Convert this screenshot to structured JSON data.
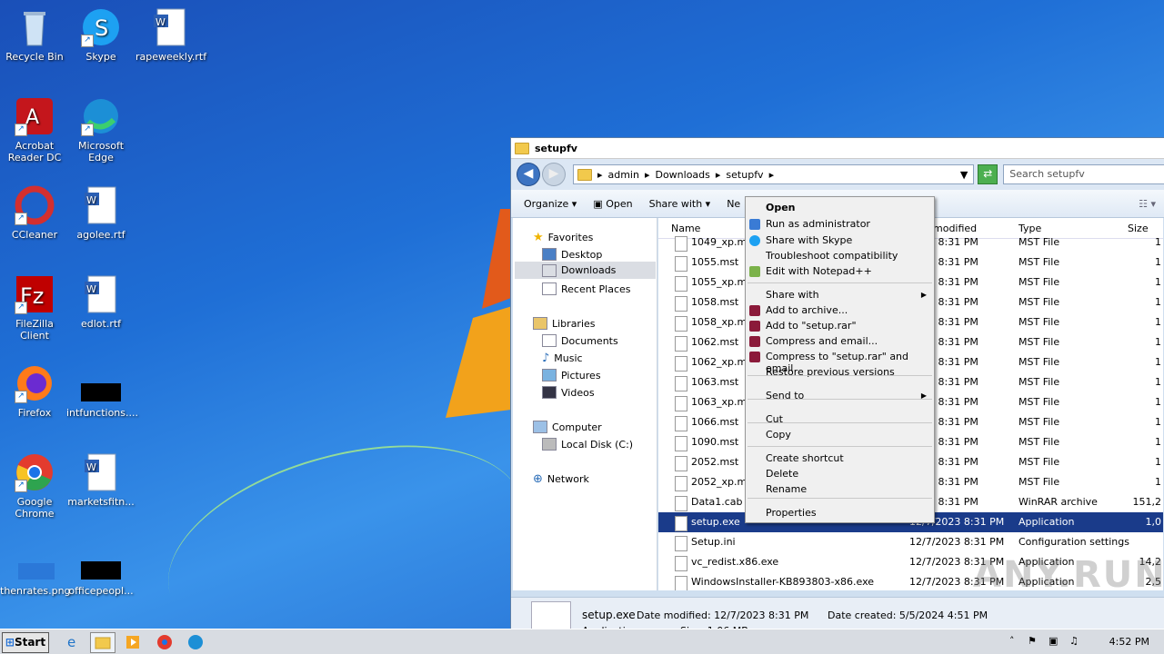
{
  "desktop": {
    "icons": [
      {
        "label": "Recycle Bin",
        "icon": "recycle-bin-icon"
      },
      {
        "label": "Skype",
        "icon": "skype-icon"
      },
      {
        "label": "rapeweekly.rtf",
        "icon": "word-doc-icon"
      },
      {
        "label": "Acrobat Reader DC",
        "icon": "acrobat-icon"
      },
      {
        "label": "Microsoft Edge",
        "icon": "edge-icon"
      },
      {
        "label": "CCleaner",
        "icon": "ccleaner-icon"
      },
      {
        "label": "agolee.rtf",
        "icon": "word-doc-icon"
      },
      {
        "label": "FileZilla Client",
        "icon": "filezilla-icon"
      },
      {
        "label": "edlot.rtf",
        "icon": "word-doc-icon"
      },
      {
        "label": "Firefox",
        "icon": "firefox-icon"
      },
      {
        "label": "intfunctions....",
        "icon": "black-file-icon"
      },
      {
        "label": "Google Chrome",
        "icon": "chrome-icon"
      },
      {
        "label": "marketsfitn...",
        "icon": "word-doc-icon"
      },
      {
        "label": "thenrates.png",
        "icon": "image-file-icon"
      },
      {
        "label": "officepeopl...",
        "icon": "black-file-icon"
      }
    ]
  },
  "explorer": {
    "title": "setupfv",
    "breadcrumb": [
      "admin",
      "Downloads",
      "setupfv"
    ],
    "search_placeholder": "Search setupfv",
    "toolbar": {
      "organize": "Organize",
      "open": "Open",
      "share_with": "Share with",
      "new": "Ne"
    },
    "nav": {
      "favorites": "Favorites",
      "desktop": "Desktop",
      "downloads": "Downloads",
      "recent": "Recent Places",
      "libraries": "Libraries",
      "documents": "Documents",
      "music": "Music",
      "pictures": "Pictures",
      "videos": "Videos",
      "computer": "Computer",
      "local_disk": "Local Disk (C:)",
      "network": "Network"
    },
    "columns": {
      "name": "Name",
      "modified": "modified",
      "type": "Type",
      "size": "Size"
    },
    "files": [
      {
        "name": "1049_xp.ms",
        "date": "2023 8:31 PM",
        "type": "MST File",
        "size": "1"
      },
      {
        "name": "1055.mst",
        "date": "2023 8:31 PM",
        "type": "MST File",
        "size": "1"
      },
      {
        "name": "1055_xp.ms",
        "date": "2023 8:31 PM",
        "type": "MST File",
        "size": "1"
      },
      {
        "name": "1058.mst",
        "date": "2023 8:31 PM",
        "type": "MST File",
        "size": "1"
      },
      {
        "name": "1058_xp.ms",
        "date": "2023 8:31 PM",
        "type": "MST File",
        "size": "1"
      },
      {
        "name": "1062.mst",
        "date": "2023 8:31 PM",
        "type": "MST File",
        "size": "1"
      },
      {
        "name": "1062_xp.ms",
        "date": "2023 8:31 PM",
        "type": "MST File",
        "size": "1"
      },
      {
        "name": "1063.mst",
        "date": "2023 8:31 PM",
        "type": "MST File",
        "size": "1"
      },
      {
        "name": "1063_xp.ms",
        "date": "2023 8:31 PM",
        "type": "MST File",
        "size": "1"
      },
      {
        "name": "1066.mst",
        "date": "2023 8:31 PM",
        "type": "MST File",
        "size": "1"
      },
      {
        "name": "1090.mst",
        "date": "2023 8:31 PM",
        "type": "MST File",
        "size": "1"
      },
      {
        "name": "2052.mst",
        "date": "2023 8:31 PM",
        "type": "MST File",
        "size": "1"
      },
      {
        "name": "2052_xp.ms",
        "date": "2023 8:31 PM",
        "type": "MST File",
        "size": "1"
      },
      {
        "name": "Data1.cab",
        "date": "2023 8:31 PM",
        "type": "WinRAR archive",
        "size": "151,2"
      },
      {
        "name": "setup.exe",
        "date": "12/7/2023 8:31 PM",
        "type": "Application",
        "size": "1,0"
      },
      {
        "name": "Setup.ini",
        "date": "12/7/2023 8:31 PM",
        "type": "Configuration settings",
        "size": ""
      },
      {
        "name": "vc_redist.x86.exe",
        "date": "12/7/2023 8:31 PM",
        "type": "Application",
        "size": "14,2"
      },
      {
        "name": "WindowsInstaller-KB893803-x86.exe",
        "date": "12/7/2023 8:31 PM",
        "type": "Application",
        "size": "2,5"
      }
    ],
    "details": {
      "filename": "setup.exe",
      "date_modified": "Date modified: 12/7/2023 8:31 PM",
      "date_created": "Date created: 5/5/2024 4:51 PM",
      "kind": "Application",
      "size": "Size: 1.06 MB"
    }
  },
  "context_menu": {
    "items": [
      "Open",
      "Run as administrator",
      "Share with Skype",
      "Troubleshoot compatibility",
      "Edit with Notepad++",
      "Share with",
      "Add to archive...",
      "Add to \"setup.rar\"",
      "Compress and email...",
      "Compress to \"setup.rar\" and email",
      "Restore previous versions",
      "Send to",
      "Cut",
      "Copy",
      "Create shortcut",
      "Delete",
      "Rename",
      "Properties"
    ]
  },
  "taskbar": {
    "start": "Start",
    "time": "4:52 PM"
  },
  "watermark": "ANY.RUN"
}
